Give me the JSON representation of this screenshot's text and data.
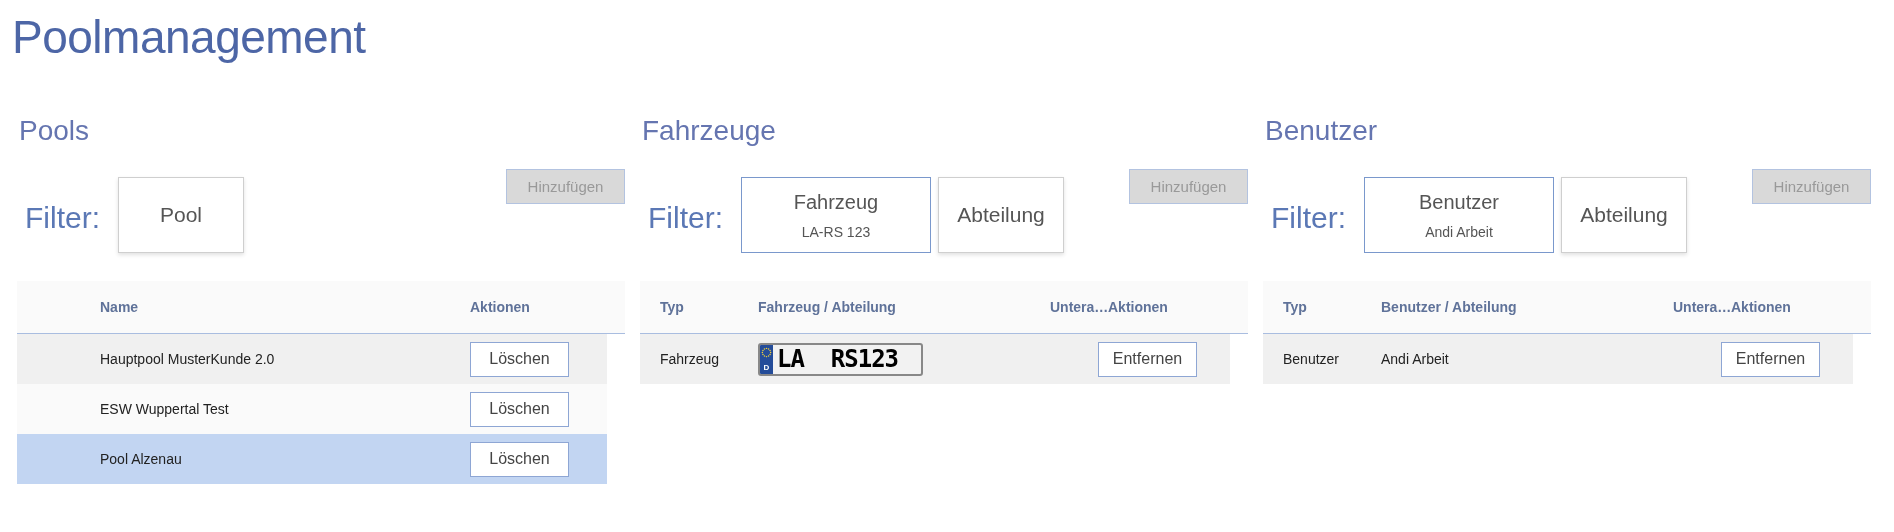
{
  "title": "Poolmanagement",
  "sections": [
    {
      "kind": "pools",
      "heading": "Pools",
      "filter_label": "Filter:",
      "filters": [
        {
          "label": "Pool",
          "selected": false
        }
      ],
      "add_button": {
        "label": "Hinzufügen",
        "disabled": true
      },
      "columns": [
        "",
        "Name",
        "Aktionen"
      ],
      "rows": [
        {
          "selected": false,
          "cells": [
            {
              "kind": "text",
              "text": ""
            },
            {
              "kind": "text",
              "text": "Hauptpool MusterKunde 2.0"
            },
            {
              "kind": "button",
              "text": "Löschen"
            }
          ]
        },
        {
          "selected": false,
          "cells": [
            {
              "kind": "text",
              "text": ""
            },
            {
              "kind": "text",
              "text": "ESW Wuppertal Test"
            },
            {
              "kind": "button",
              "text": "Löschen"
            }
          ]
        },
        {
          "selected": true,
          "cells": [
            {
              "kind": "text",
              "text": ""
            },
            {
              "kind": "text",
              "text": "Pool Alzenau"
            },
            {
              "kind": "button",
              "text": "Löschen"
            }
          ]
        }
      ]
    },
    {
      "kind": "assignments",
      "heading": "Fahrzeuge",
      "filter_label": "Filter:",
      "filters": [
        {
          "label": "Fahrzeug",
          "value": "LA-RS 123",
          "selected": true
        },
        {
          "label": "Abteilung",
          "selected": false
        }
      ],
      "add_button": {
        "label": "Hinzufügen",
        "disabled": true
      },
      "columns": [
        "Typ",
        "Fahrzeug / Abteilung",
        "Untera…",
        "Aktionen"
      ],
      "rows": [
        {
          "selected": false,
          "cells": [
            {
              "kind": "text",
              "text": "Fahrzeug"
            },
            {
              "kind": "plate",
              "country": "D",
              "text": "LA  RS123"
            },
            {
              "kind": "text",
              "text": ""
            },
            {
              "kind": "button",
              "text": "Entfernen"
            }
          ]
        }
      ]
    },
    {
      "kind": "assignments",
      "heading": "Benutzer",
      "filter_label": "Filter:",
      "filters": [
        {
          "label": "Benutzer",
          "value": "Andi Arbeit",
          "selected": true
        },
        {
          "label": "Abteilung",
          "selected": false
        }
      ],
      "add_button": {
        "label": "Hinzufügen",
        "disabled": true
      },
      "columns": [
        "Typ",
        "Benutzer / Abteilung",
        "Untera…",
        "Aktionen"
      ],
      "rows": [
        {
          "selected": false,
          "cells": [
            {
              "kind": "text",
              "text": "Benutzer"
            },
            {
              "kind": "text",
              "text": "Andi Arbeit"
            },
            {
              "kind": "text",
              "text": ""
            },
            {
              "kind": "button",
              "text": "Entfernen"
            }
          ]
        }
      ]
    }
  ]
}
